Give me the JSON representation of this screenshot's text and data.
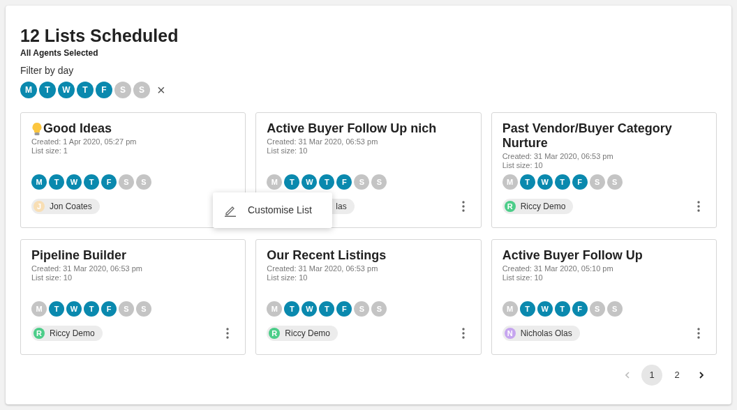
{
  "title": "12 Lists Scheduled",
  "subtitle": "All Agents Selected",
  "filter": {
    "label": "Filter by day",
    "days": [
      {
        "label": "M",
        "on": true
      },
      {
        "label": "T",
        "on": true
      },
      {
        "label": "W",
        "on": true
      },
      {
        "label": "T",
        "on": true
      },
      {
        "label": "F",
        "on": true
      },
      {
        "label": "S",
        "on": false
      },
      {
        "label": "S",
        "on": false
      }
    ],
    "clear": "×"
  },
  "cards": [
    {
      "kind": "idea",
      "title": "Good Ideas",
      "created": "Created: 1 Apr 2020, 05:27 pm",
      "size": "List size: 1",
      "menu_button": false,
      "agent": {
        "initial": "J",
        "name": "Jon Coates",
        "color": "#f8deb4"
      },
      "days": [
        {
          "label": "M",
          "on": true
        },
        {
          "label": "T",
          "on": true
        },
        {
          "label": "W",
          "on": true
        },
        {
          "label": "T",
          "on": true
        },
        {
          "label": "F",
          "on": true
        },
        {
          "label": "S",
          "on": false
        },
        {
          "label": "S",
          "on": false
        }
      ]
    },
    {
      "title": "Active Buyer Follow Up nich",
      "created": "Created: 31 Mar 2020, 06:53 pm",
      "size": "List size: 10",
      "menu_button": true,
      "agent": {
        "name": "las"
      },
      "days": [
        {
          "label": "M",
          "on": false
        },
        {
          "label": "T",
          "on": true
        },
        {
          "label": "W",
          "on": true
        },
        {
          "label": "T",
          "on": true
        },
        {
          "label": "F",
          "on": true
        },
        {
          "label": "S",
          "on": false
        },
        {
          "label": "S",
          "on": false
        }
      ]
    },
    {
      "title": "Past Vendor/Buyer Category Nurture",
      "created": "Created: 31 Mar 2020, 06:53 pm",
      "size": "List size: 10",
      "menu_button": true,
      "agent": {
        "initial": "R",
        "name": "Riccy Demo",
        "color": "#4ccd89"
      },
      "days": [
        {
          "label": "M",
          "on": false
        },
        {
          "label": "T",
          "on": true
        },
        {
          "label": "W",
          "on": true
        },
        {
          "label": "T",
          "on": true
        },
        {
          "label": "F",
          "on": true
        },
        {
          "label": "S",
          "on": false
        },
        {
          "label": "S",
          "on": false
        }
      ]
    },
    {
      "title": "Pipeline Builder",
      "created": "Created: 31 Mar 2020, 06:53 pm",
      "size": "List size: 10",
      "menu_button": true,
      "agent": {
        "initial": "R",
        "name": "Riccy Demo",
        "color": "#4ccd89"
      },
      "days": [
        {
          "label": "M",
          "on": false
        },
        {
          "label": "T",
          "on": true
        },
        {
          "label": "W",
          "on": true
        },
        {
          "label": "T",
          "on": true
        },
        {
          "label": "F",
          "on": true
        },
        {
          "label": "S",
          "on": false
        },
        {
          "label": "S",
          "on": false
        }
      ]
    },
    {
      "title": "Our Recent Listings",
      "created": "Created: 31 Mar 2020, 06:53 pm",
      "size": "List size: 10",
      "menu_button": true,
      "agent": {
        "initial": "R",
        "name": "Riccy Demo",
        "color": "#4ccd89"
      },
      "days": [
        {
          "label": "M",
          "on": false
        },
        {
          "label": "T",
          "on": true
        },
        {
          "label": "W",
          "on": true
        },
        {
          "label": "T",
          "on": true
        },
        {
          "label": "F",
          "on": true
        },
        {
          "label": "S",
          "on": false
        },
        {
          "label": "S",
          "on": false
        }
      ]
    },
    {
      "title": "Active Buyer Follow Up",
      "created": "Created: 31 Mar 2020, 05:10 pm",
      "size": "List size: 10",
      "menu_button": true,
      "agent": {
        "initial": "N",
        "name": "Nicholas Olas",
        "color": "#c6a5ef"
      },
      "days": [
        {
          "label": "M",
          "on": false
        },
        {
          "label": "T",
          "on": true
        },
        {
          "label": "W",
          "on": true
        },
        {
          "label": "T",
          "on": true
        },
        {
          "label": "F",
          "on": true
        },
        {
          "label": "S",
          "on": false
        },
        {
          "label": "S",
          "on": false
        }
      ]
    }
  ],
  "menu": {
    "items": [
      "Customise List"
    ]
  },
  "pagination": {
    "pages": [
      {
        "label": "1",
        "selected": true
      },
      {
        "label": "2",
        "selected": false
      }
    ]
  }
}
